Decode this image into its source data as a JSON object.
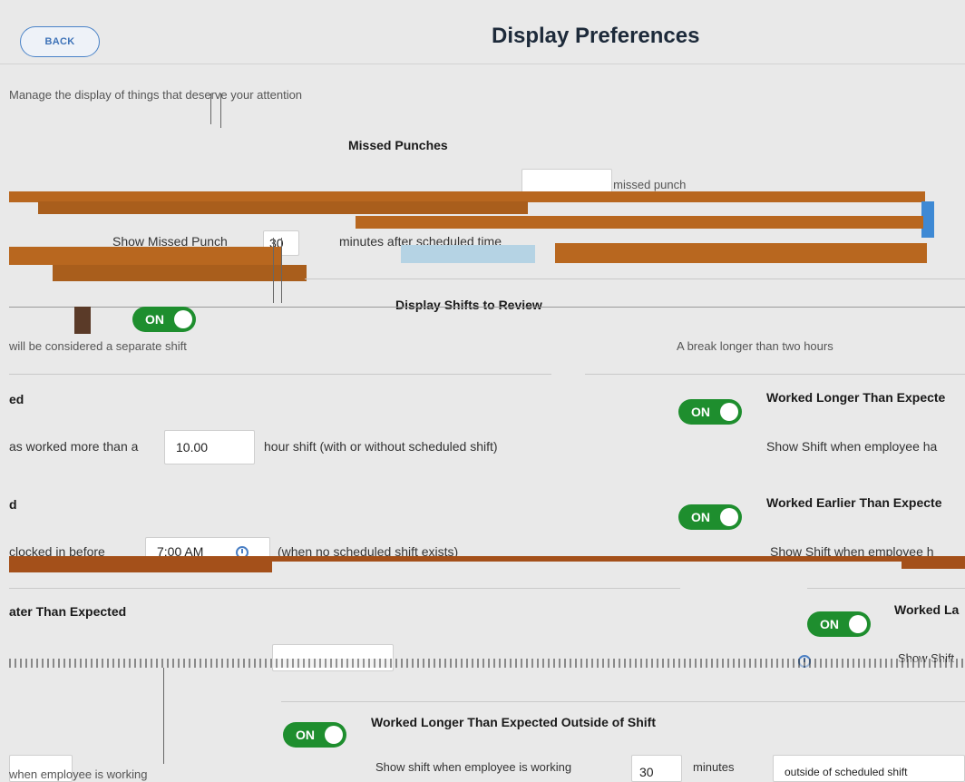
{
  "header": {
    "back_label": "BACK",
    "title": "Display Preferences"
  },
  "intro_text": "Manage the display of things that deserve your attention",
  "missed_punches": {
    "heading": "Missed Punches",
    "description": "Show missed punch",
    "show_label": "Show Missed Punch",
    "minutes_value": "30",
    "after_text": "minutes after scheduled time"
  },
  "shifts_section": {
    "heading": "Display Shifts to Review",
    "master_toggle": "ON",
    "break_note_left": "will be considered a separate shift",
    "break_note_right": "A break longer than two hours"
  },
  "cards": [
    {
      "id": "worked-longer-left",
      "title": "ed",
      "toggle": "ON",
      "desc_prefix": "as worked more than a",
      "value": "10.00",
      "desc_suffix": "hour shift (with or without scheduled shift)"
    },
    {
      "id": "worked-longer-right",
      "title": "Worked Longer Than Expecte",
      "toggle": "ON",
      "desc_prefix": "Show Shift when employee ha"
    },
    {
      "id": "worked-earlier-left",
      "title": "d",
      "desc_prefix": "clocked in before",
      "value": "7:00 AM",
      "desc_suffix": "(when no scheduled shift exists)"
    },
    {
      "id": "worked-earlier-right",
      "title": "Worked Earlier Than Expecte",
      "toggle": "ON",
      "desc_prefix": "Show Shift when employee h"
    },
    {
      "id": "worked-later-left",
      "title": "ater Than Expected"
    },
    {
      "id": "worked-later-right",
      "title": "Worked La",
      "toggle": "ON",
      "desc_prefix": "Show Shift"
    },
    {
      "id": "worked-longer-outside",
      "title": "Worked Longer Than Expected Outside of Shift",
      "toggle": "ON",
      "desc_prefix": "Show shift when employee is working",
      "value": "30",
      "desc_suffix": "minutes",
      "bottom_left": "when employee is working",
      "bottom_right": "outside of scheduled shift"
    }
  ],
  "colors": {
    "toggle_green": "#1e8e2e",
    "accent_blue": "#4a83c8",
    "glitch_brown": "#b8671f"
  }
}
